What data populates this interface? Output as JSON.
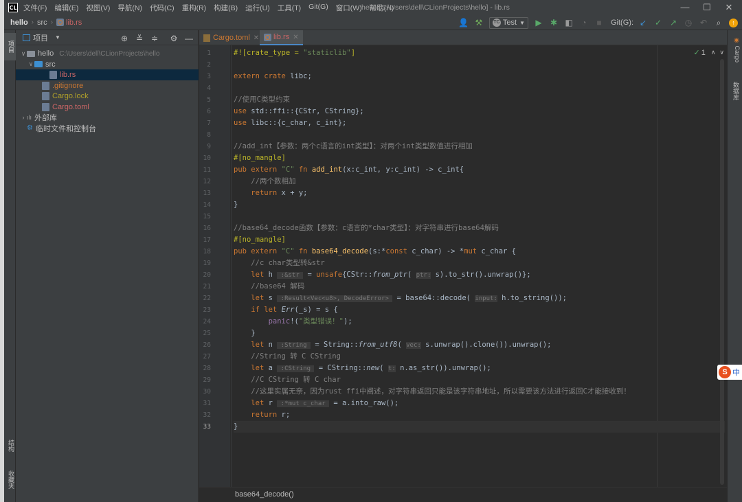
{
  "app": {
    "logo_text": "CL",
    "menu": [
      "文件(F)",
      "编辑(E)",
      "视图(V)",
      "导航(N)",
      "代码(C)",
      "重构(R)",
      "构建(B)",
      "运行(U)",
      "工具(T)",
      "Git(G)",
      "窗口(W)",
      "帮助(H)"
    ],
    "window_title": "hello [C:\\Users\\dell\\CLionProjects\\hello] - lib.rs",
    "controls": {
      "minimize": "—",
      "maximize": "☐",
      "close": "✕"
    }
  },
  "nav": {
    "crumbs": [
      "hello",
      "src",
      "lib.rs"
    ],
    "run_config": "Test",
    "run_config_icon": "TC",
    "git_label": "Git(G):",
    "icons": [
      "user-icon",
      "hammer-icon",
      "run-icon",
      "debug-icon",
      "coverage-icon",
      "profile-icon",
      "stop-icon",
      "git-update-icon",
      "git-commit-icon",
      "git-push-icon",
      "history-icon",
      "rollback-icon",
      "search-icon",
      "update-icon"
    ]
  },
  "left_strip": {
    "top_tab": "项目",
    "bottom_tabs": [
      "结构",
      "收藏夹"
    ]
  },
  "project": {
    "title": "项目",
    "tree": [
      {
        "label": "hello",
        "path": "C:\\Users\\dell\\CLionProjects\\hello",
        "indent": 0,
        "arrow": "∨",
        "icon": "folder",
        "color": "#bbbbbb"
      },
      {
        "label": "src",
        "path": "",
        "indent": 1,
        "arrow": "∨",
        "icon": "folder-blue",
        "color": "#bbbbbb"
      },
      {
        "label": "lib.rs",
        "path": "",
        "indent": 3,
        "arrow": "",
        "icon": "rust-file",
        "color": "#cc6666",
        "selected": true
      },
      {
        "label": ".gitignore",
        "path": "",
        "indent": 2,
        "arrow": "",
        "icon": "gitignore-file",
        "color": "#cc7832"
      },
      {
        "label": "Cargo.lock",
        "path": "",
        "indent": 2,
        "arrow": "",
        "icon": "lock-file",
        "color": "#b0a02a"
      },
      {
        "label": "Cargo.toml",
        "path": "",
        "indent": 2,
        "arrow": "",
        "icon": "toml-file",
        "color": "#cc6666"
      },
      {
        "label": "外部库",
        "path": "",
        "indent": 0,
        "arrow": "›",
        "icon": "library",
        "color": "#bbbbbb"
      },
      {
        "label": "临时文件和控制台",
        "path": "",
        "indent": 0,
        "arrow": "",
        "icon": "scratch",
        "color": "#bbbbbb"
      }
    ]
  },
  "editor": {
    "tabs": [
      {
        "label": "Cargo.toml",
        "color": "#cc7832",
        "active": false
      },
      {
        "label": "lib.rs",
        "color": "#cc6666",
        "active": true
      }
    ],
    "inspection": "1",
    "current_line": 33,
    "lines": [
      "#![crate_type = \"staticlib\"]",
      "",
      "extern crate libc;",
      "",
      "//使用C类型约束",
      "use std::ffi::{CStr, CString};",
      "use libc::{c_char, c_int};",
      "",
      "//add_int【参数：两个c语言的int类型】：对两个int类型数值进行相加",
      "#[no_mangle]",
      "pub extern \"C\" fn add_int(x:c_int, y:c_int) -> c_int{",
      "    //两个数相加",
      "    return x + y;",
      "}",
      "",
      "//base64_decode函数【参数：c语言的*char类型】：对字符串进行base64解码",
      "#[no_mangle]",
      "pub extern \"C\" fn base64_decode(s:*const c_char) -> *mut c_char {",
      "    //c char类型转&str",
      "    let h :&str  = unsafe{CStr::from_ptr( ptr: s).to_str().unwrap()};",
      "    //base64 解码",
      "    let s :Result<Vec<u8>, DecodeError>  = base64::decode( input: h.to_string());",
      "    if let Err(_s) = s {",
      "        panic!(\"类型错误！\");",
      "    }",
      "    let n :String  = String::from_utf8( vec: s.unwrap().clone()).unwrap();",
      "    //String 转 C CString",
      "    let a :CString  = CString::new( t: n.as_str()).unwrap();",
      "    //C CString 转 C char",
      "    //这里实属无奈，因为rust ffi中阐述，对字符串返回只能是该字符串地址，所以需要该方法进行返回C才能接收到！",
      "    let r :*mut c_char  = a.into_raw();",
      "    return r;",
      "}"
    ],
    "breadcrumb": "base64_decode()"
  },
  "right_strip": {
    "tabs": [
      "Cargo",
      "数据库"
    ]
  },
  "ime": {
    "logo": "S",
    "text": "中"
  },
  "colors": {
    "keyword": "#cc7832",
    "string": "#6a8759",
    "comment": "#808080",
    "function": "#ffc66d",
    "attr": "#bbb529",
    "hint": "#787878"
  }
}
